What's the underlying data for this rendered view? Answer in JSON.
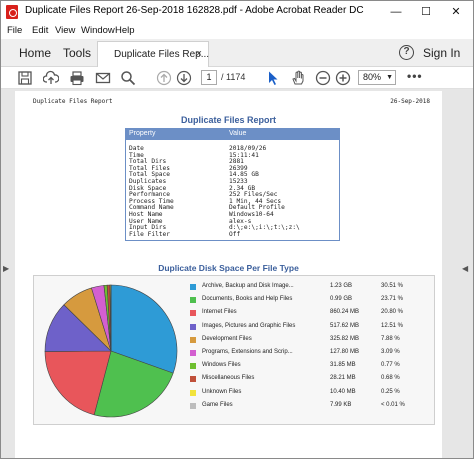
{
  "window": {
    "title": "Duplicate Files Report 26-Sep-2018 162828.pdf - Adobe Acrobat Reader DC",
    "min": "—",
    "max": "☐",
    "close": "✕"
  },
  "menu": [
    "File",
    "Edit",
    "View",
    "Window",
    "Help"
  ],
  "tabs": {
    "home": "Home",
    "tools": "Tools",
    "doc": "Duplicate Files Rep...",
    "doc_close": "×",
    "signin": "Sign In",
    "help": "?"
  },
  "toolbar": {
    "page": "1",
    "total": "/ 1174",
    "zoom": "80%",
    "zoom_arrow": "▼",
    "more": "•••"
  },
  "report": {
    "header_left": "Duplicate Files Report",
    "header_right": "26-Sep-2018",
    "title": "Duplicate Files Report",
    "table_header": [
      "Property",
      "Value"
    ],
    "properties": [
      [
        "Date",
        "2018/09/26"
      ],
      [
        "Time",
        "15:11:41"
      ],
      [
        "Total Dirs",
        "2881"
      ],
      [
        "Total Files",
        "26399"
      ],
      [
        "Total Space",
        "14.85 GB"
      ],
      [
        "Duplicates",
        "15233"
      ],
      [
        "Disk Space",
        "2.34 GB"
      ],
      [
        "Performance",
        "252 Files/Sec"
      ],
      [
        "Process Time",
        "1 Min, 44 Secs"
      ],
      [
        "Command Name",
        "Default Profile"
      ],
      [
        "Host Name",
        "Windows10-64"
      ],
      [
        "User Name",
        "alex-s"
      ],
      [
        "Input Dirs",
        "d:\\;e:\\;i:\\;t:\\;z:\\"
      ],
      [
        "File Filter",
        "Off"
      ]
    ],
    "chart_title": "Duplicate Disk Space Per File Type"
  },
  "chart_data": {
    "type": "pie",
    "title": "Duplicate Disk Space Per File Type",
    "categories": [
      "Archive, Backup and Disk Image...",
      "Documents, Books and Help Files",
      "Internet Files",
      "Images, Pictures and Graphic Files",
      "Development Files",
      "Programs, Extensions and Scrip...",
      "Windows Files",
      "Miscellaneous Files",
      "Unknown Files",
      "Game Files"
    ],
    "sizes": [
      "1.23 GB",
      "0.99 GB",
      "860.24 MB",
      "517.62 MB",
      "325.82 MB",
      "127.80 MB",
      "31.85 MB",
      "28.21 MB",
      "10.40 MB",
      "7.99 KB"
    ],
    "percent_labels": [
      "30.51 %",
      "23.71 %",
      "20.80 %",
      "12.51 %",
      "7.88 %",
      "3.09 %",
      "0.77 %",
      "0.68 %",
      "0.25 %",
      "< 0.01 %"
    ],
    "values": [
      30.51,
      23.71,
      20.8,
      12.51,
      7.88,
      3.09,
      0.77,
      0.68,
      0.25,
      0.005
    ],
    "colors": [
      "#2e9bd6",
      "#4fc04f",
      "#e8565b",
      "#6e61c9",
      "#d69a3e",
      "#d35fd0",
      "#6fbf2f",
      "#c0503a",
      "#f2e33c",
      "#bdbdbd"
    ]
  }
}
